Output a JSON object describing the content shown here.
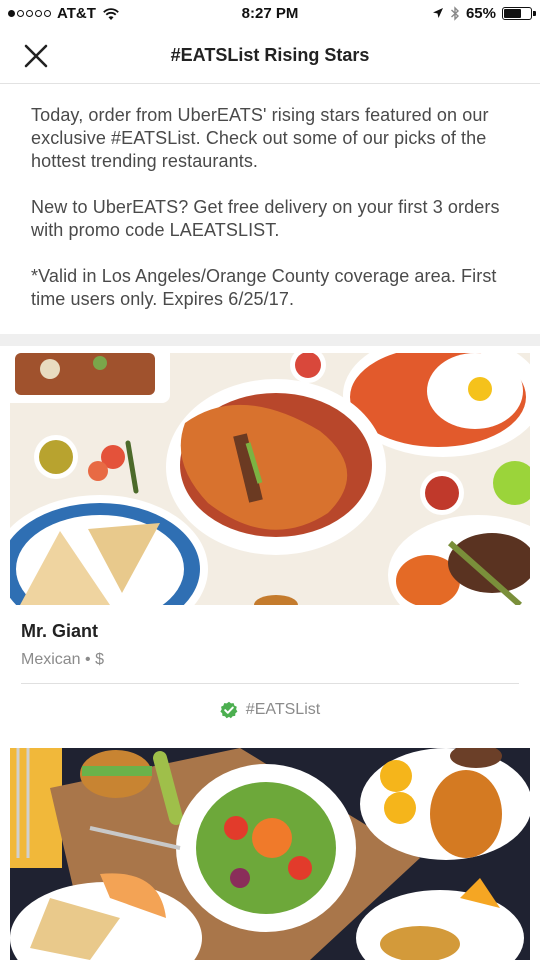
{
  "status_bar": {
    "carrier": "AT&T",
    "time": "8:27 PM",
    "battery_percent": "65%",
    "battery_level": 0.65,
    "signal_bars_filled": 1,
    "signal_bars_total": 5
  },
  "nav": {
    "title": "#EATSList Rising Stars",
    "close_icon": "close-icon"
  },
  "intro": {
    "paragraph_1": "Today, order from UberEATS' rising stars featured on our exclusive #EATSList. Check out some of our picks of the hottest trending restaurants.",
    "paragraph_2": "New to UberEATS? Get free delivery on your first 3 orders with promo code LAEATSLIST.",
    "paragraph_3": "*Valid in Los Angeles/Orange County coverage area. First time users only. Expires 6/25/17."
  },
  "restaurants": [
    {
      "name": "Mr. Giant",
      "meta": "Mexican • $",
      "tag": "#EATSList",
      "tag_icon": "check-badge-icon",
      "tag_color": "#4caf50"
    },
    {
      "name": "",
      "meta": ""
    }
  ]
}
